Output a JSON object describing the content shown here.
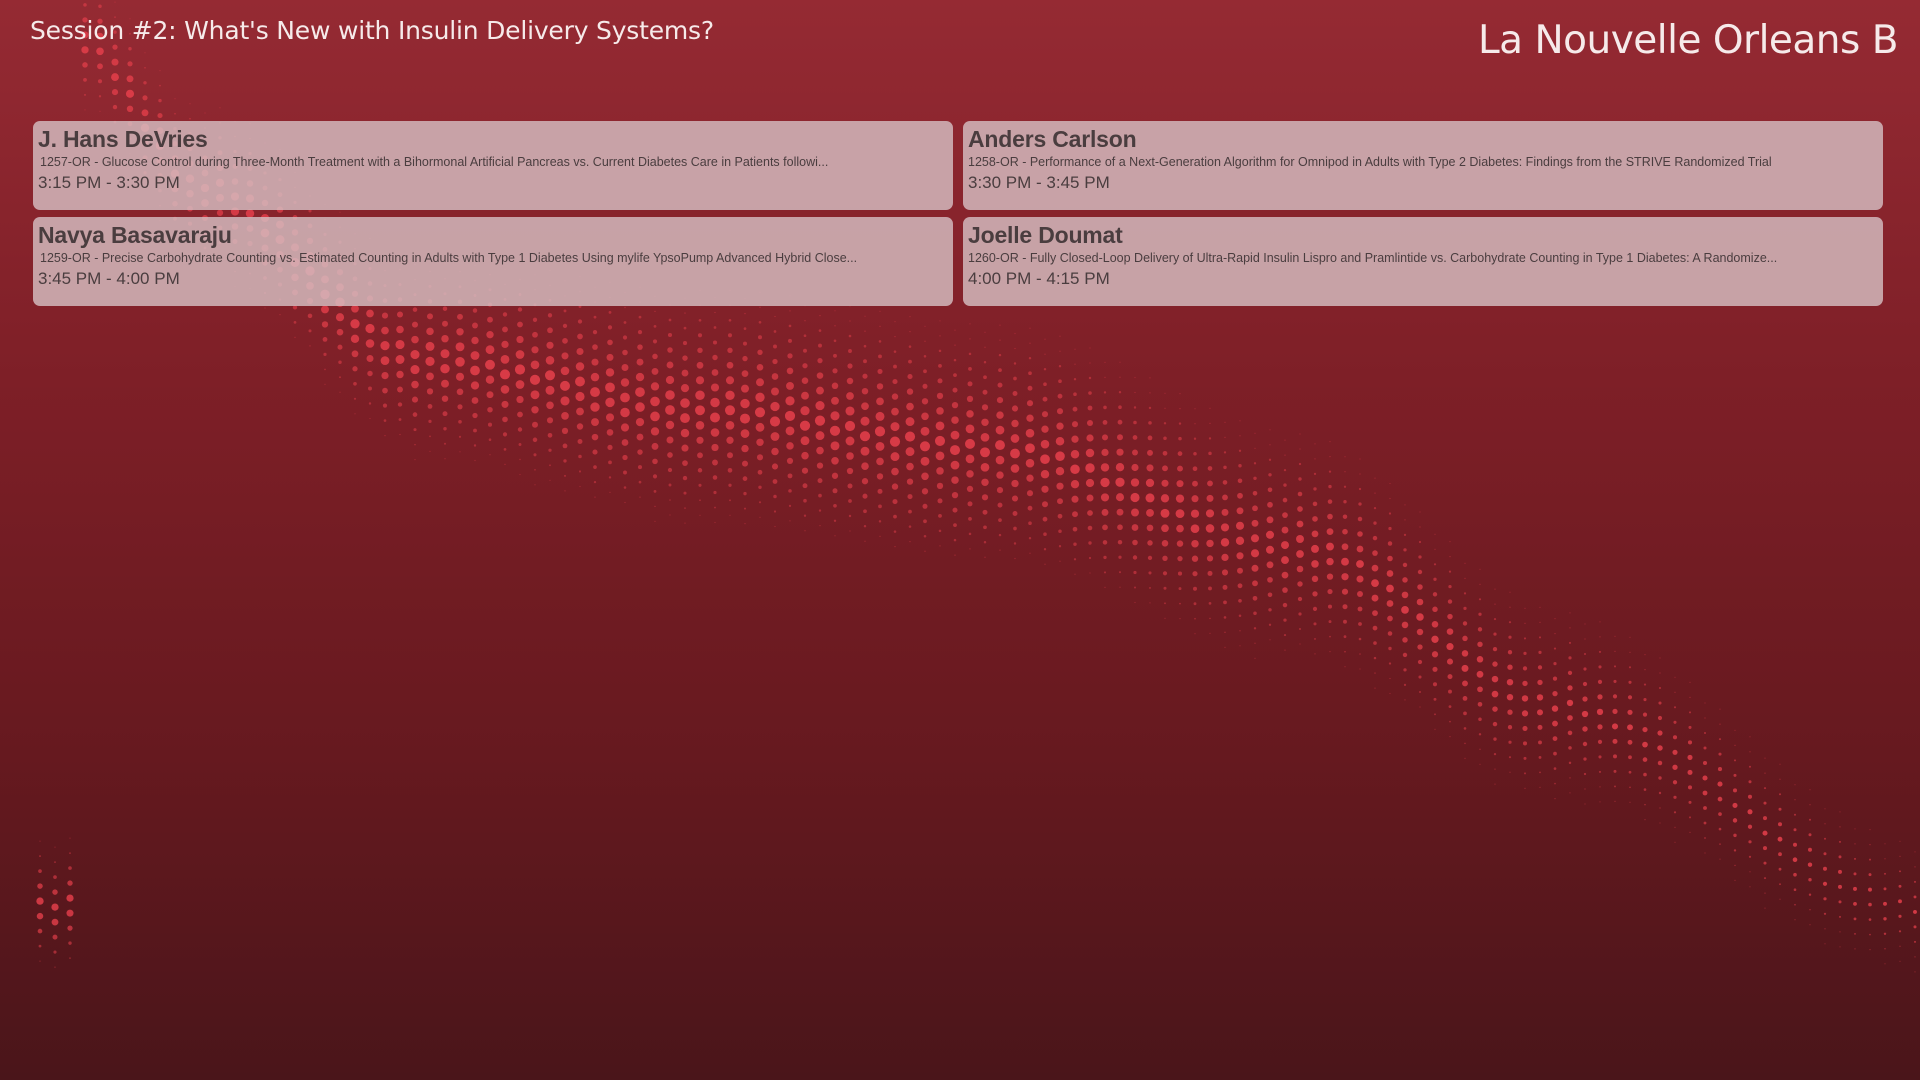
{
  "header": {
    "session_title": "Session #2: What's New with Insulin Delivery Systems?",
    "room_name": "La Nouvelle Orleans B"
  },
  "sessions": [
    {
      "speaker": "J. Hans DeVries",
      "abstract": "1257-OR - Glucose Control during Three-Month Treatment with a Bihormonal Artificial Pancreas vs. Current Diabetes Care in Patients followi...",
      "time": "3:15 PM - 3:30 PM"
    },
    {
      "speaker": "Anders Carlson",
      "abstract": "1258-OR - Performance of a Next-Generation Algorithm for Omnipod in Adults with Type 2 Diabetes: Findings from the STRIVE Randomized Trial",
      "time": "3:30 PM - 3:45 PM"
    },
    {
      "speaker": "Navya Basavaraju",
      "abstract": "1259-OR - Precise Carbohydrate Counting vs. Estimated Counting in Adults with Type 1 Diabetes Using mylife YpsoPump Advanced Hybrid Close...",
      "time": "3:45 PM - 4:00 PM"
    },
    {
      "speaker": "Joelle Doumat",
      "abstract": "1260-OR - Fully Closed-Loop Delivery of Ultra-Rapid Insulin Lispro and Pramlintide vs. Carbohydrate Counting in Type 1 Diabetes: A Randomize...",
      "time": "4:00 PM - 4:15 PM"
    }
  ],
  "colors": {
    "background_top": "#952a33",
    "background_bottom": "#4a151a",
    "dot_accent": "#e8404c",
    "card_fill": "#d6bec2",
    "card_text": "#4a3d3f",
    "header_text": "#f6eaea"
  }
}
